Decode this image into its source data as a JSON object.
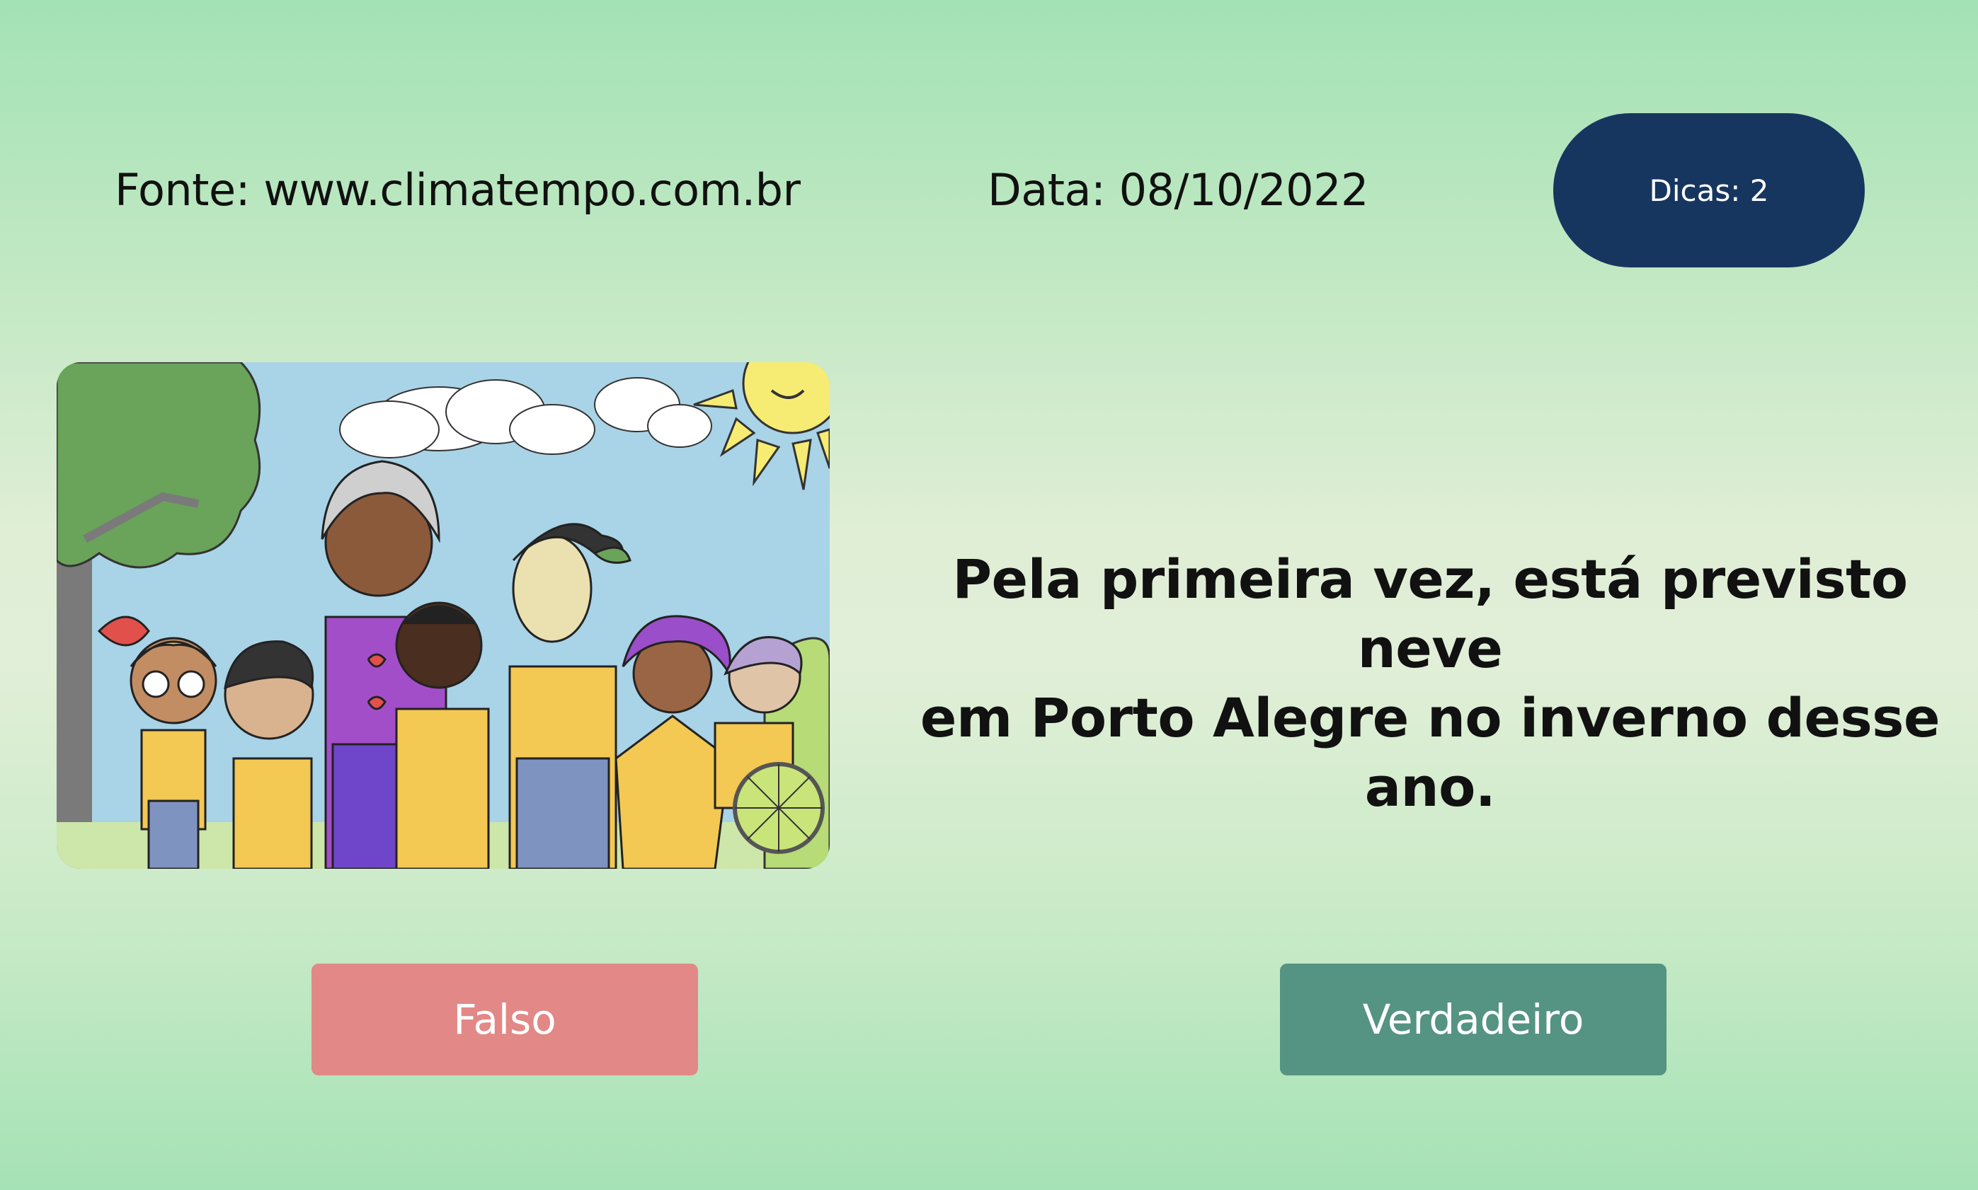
{
  "header": {
    "source_text": "Fonte: www.climatempo.com.br",
    "date_text": "Data: 08/10/2022",
    "hints_label": "Dicas: 2"
  },
  "illustration": {
    "description_icon": "children-group-drawing-image"
  },
  "question": {
    "line1": "Pela primeira vez, está previsto neve",
    "line2": "em Porto Alegre no inverno desse ano."
  },
  "answers": {
    "false_label": "Falso",
    "true_label": "Verdadeiro"
  },
  "colors": {
    "hints_button": "#17365f",
    "false_button": "#e28886",
    "true_button": "#559383"
  }
}
